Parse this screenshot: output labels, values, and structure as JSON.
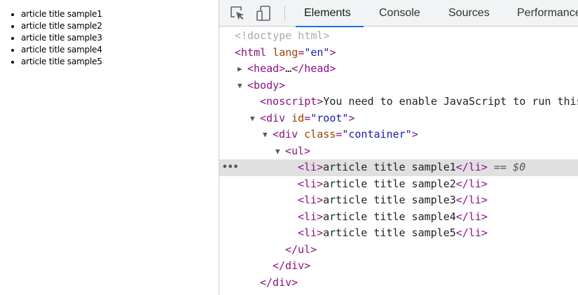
{
  "page": {
    "items": [
      "article title sample1",
      "article title sample2",
      "article title sample3",
      "article title sample4",
      "article title sample5"
    ]
  },
  "devtools": {
    "tabs": [
      "Elements",
      "Console",
      "Sources",
      "Performance"
    ],
    "active_tab": "Elements",
    "tree": {
      "doctype": "<!doctype html>",
      "html_open_tag": "<html",
      "lang_attr": "lang",
      "lang_val": "\"en\"",
      "head_open": "<head>",
      "head_ellipsis": "…",
      "head_close": "</head>",
      "body_open": "<body>",
      "noscript_open": "<noscript>",
      "noscript_text": "You need to enable JavaScript to run this app.",
      "div_root_tag": "<div",
      "id_attr": "id",
      "root_val": "\"root\"",
      "div_container_tag": "<div",
      "class_attr": "class",
      "container_val": "\"container\"",
      "ul_open": "<ul>",
      "li_open": "<li>",
      "li_close": "</li>",
      "li_items": [
        "article title sample1",
        "article title sample2",
        "article title sample3",
        "article title sample4",
        "article title sample5"
      ],
      "selected_marker": "== $0",
      "ul_close": "</ul>",
      "div_close": "</div>",
      "div_close2": "</div>"
    }
  }
}
